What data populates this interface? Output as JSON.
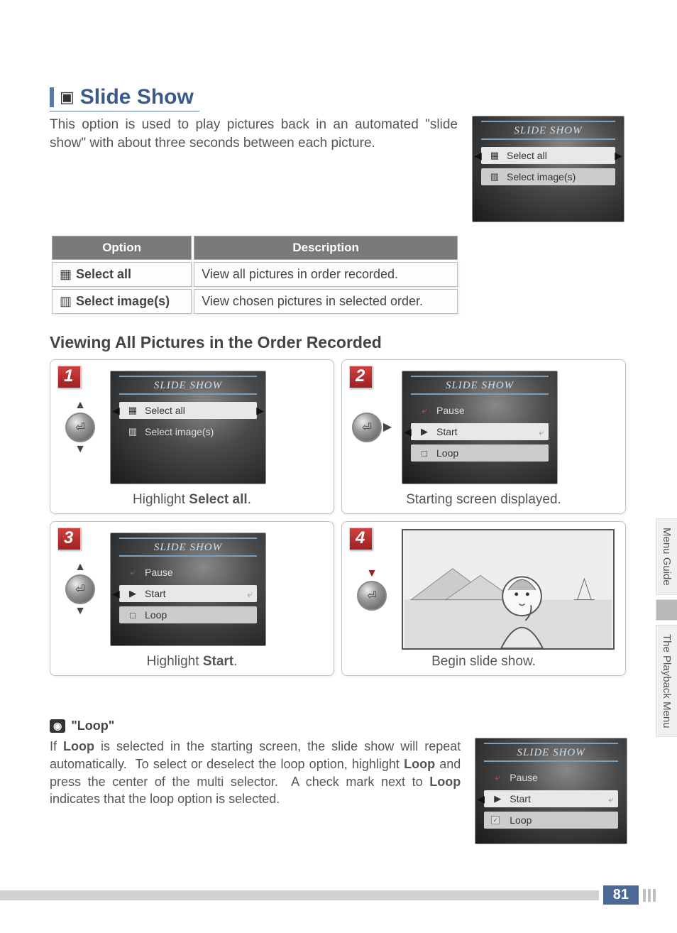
{
  "title": "Slide Show",
  "intro": "This option is used to play pictures back in an automated \"slide show\" with about three seconds between each picture.",
  "topLcd": {
    "title": "SLIDE SHOW",
    "items": [
      "Select all",
      "Select image(s)"
    ]
  },
  "table": {
    "headers": [
      "Option",
      "Description"
    ],
    "rows": [
      {
        "option": "Select all",
        "desc": "View all pictures in order recorded."
      },
      {
        "option": "Select image(s)",
        "desc": "View chosen pictures in selected order."
      }
    ]
  },
  "subhead": "Viewing All Pictures in the Order Recorded",
  "steps": [
    {
      "num": "1",
      "lcd": {
        "title": "SLIDE SHOW",
        "items": [
          {
            "label": "Select all",
            "hl": true
          },
          {
            "label": "Select image(s)"
          }
        ]
      },
      "captionPre": "Highlight ",
      "captionBold": "Select all",
      "captionPost": "."
    },
    {
      "num": "2",
      "lcd": {
        "title": "SLIDE SHOW",
        "items": [
          {
            "label": "Pause",
            "icon": "⤶"
          },
          {
            "label": "Start",
            "hl": true,
            "icon": "▶"
          },
          {
            "label": "Loop",
            "icon": "□"
          }
        ]
      },
      "caption": "Starting screen displayed."
    },
    {
      "num": "3",
      "lcd": {
        "title": "SLIDE SHOW",
        "items": [
          {
            "label": "Pause",
            "icon": "⤶"
          },
          {
            "label": "Start",
            "hl": true,
            "icon": "▶"
          },
          {
            "label": "Loop",
            "icon": "□"
          }
        ]
      },
      "captionPre": "Highlight ",
      "captionBold": "Start",
      "captionPost": "."
    },
    {
      "num": "4",
      "caption": "Begin slide show."
    }
  ],
  "note": {
    "title": "\"Loop\"",
    "body": "If Loop is selected in the starting screen, the slide show will repeat automatically.  To select or deselect the loop option, highlight Loop and press the center of the multi selector.  A check mark next to Loop indicates that the loop option is selected.",
    "lcd": {
      "title": "SLIDE SHOW",
      "items": [
        {
          "label": "Pause",
          "icon": "⤶"
        },
        {
          "label": "Start",
          "hl": true,
          "icon": "▶"
        },
        {
          "label": "Loop",
          "icon": "✓",
          "checked": true
        }
      ]
    }
  },
  "sidebar": [
    "Menu Guide",
    "The Playback Menu"
  ],
  "pageNumber": "81"
}
